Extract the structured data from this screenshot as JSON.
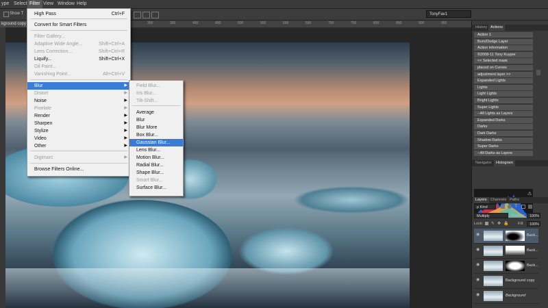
{
  "menubar": {
    "items": [
      "ype",
      "Select",
      "Filter",
      "View",
      "Window",
      "Help"
    ],
    "active_index": 2
  },
  "options": {
    "show_label": "Show T",
    "workspace": "TonyFav1"
  },
  "document": {
    "tab_label": "kground copy 5,",
    "ruler_ticks": [
      "50",
      "100",
      "150",
      "200",
      "250",
      "300",
      "350",
      "400",
      "450",
      "500",
      "550",
      "600",
      "650",
      "700",
      "750",
      "800",
      "850",
      "900",
      "950"
    ]
  },
  "filter_menu": {
    "items": [
      {
        "label": "High Pass",
        "shortcut": "Ctrl+F",
        "disabled": false
      },
      {
        "label": "Convert for Smart Filters",
        "shortcut": "",
        "disabled": false
      },
      {
        "label": "Filter Gallery...",
        "shortcut": "",
        "disabled": true
      },
      {
        "label": "Adaptive Wide Angle...",
        "shortcut": "Shift+Ctrl+A",
        "disabled": true
      },
      {
        "label": "Lens Correction...",
        "shortcut": "Shift+Ctrl+R",
        "disabled": true
      },
      {
        "label": "Liquify...",
        "shortcut": "Shift+Ctrl+X",
        "disabled": false
      },
      {
        "label": "Oil Paint...",
        "shortcut": "",
        "disabled": true
      },
      {
        "label": "Vanishing Point...",
        "shortcut": "Alt+Ctrl+V",
        "disabled": true
      },
      {
        "label": "Blur",
        "shortcut": "",
        "disabled": false,
        "submenu": true
      },
      {
        "label": "Distort",
        "shortcut": "",
        "disabled": true,
        "submenu": true
      },
      {
        "label": "Noise",
        "shortcut": "",
        "disabled": false,
        "submenu": true
      },
      {
        "label": "Pixelate",
        "shortcut": "",
        "disabled": true,
        "submenu": true
      },
      {
        "label": "Render",
        "shortcut": "",
        "disabled": false,
        "submenu": true
      },
      {
        "label": "Sharpen",
        "shortcut": "",
        "disabled": false,
        "submenu": true
      },
      {
        "label": "Stylize",
        "shortcut": "",
        "disabled": false,
        "submenu": true
      },
      {
        "label": "Video",
        "shortcut": "",
        "disabled": false,
        "submenu": true
      },
      {
        "label": "Other",
        "shortcut": "",
        "disabled": false,
        "submenu": true
      },
      {
        "label": "Digimarc",
        "shortcut": "",
        "disabled": true,
        "submenu": true
      },
      {
        "label": "Browse Filters Online...",
        "shortcut": "",
        "disabled": false
      }
    ]
  },
  "blur_menu": {
    "items": [
      {
        "label": "Field Blur...",
        "disabled": true
      },
      {
        "label": "Iris Blur...",
        "disabled": true
      },
      {
        "label": "Tilt-Shift...",
        "disabled": true
      },
      {
        "label": "Average",
        "disabled": false
      },
      {
        "label": "Blur",
        "disabled": false
      },
      {
        "label": "Blur More",
        "disabled": false
      },
      {
        "label": "Box Blur...",
        "disabled": false
      },
      {
        "label": "Gaussian Blur...",
        "disabled": false,
        "highlighted": true
      },
      {
        "label": "Lens Blur...",
        "disabled": false
      },
      {
        "label": "Motion Blur...",
        "disabled": false
      },
      {
        "label": "Radial Blur...",
        "disabled": false
      },
      {
        "label": "Shape Blur...",
        "disabled": false
      },
      {
        "label": "Smart Blur...",
        "disabled": true
      },
      {
        "label": "Surface Blur...",
        "disabled": false
      }
    ]
  },
  "actions_panel": {
    "tabs": [
      "History",
      "Actions"
    ],
    "items": [
      "Action 1",
      "Burn/Dodge Layer",
      "Action information",
      "©2008-11 Tony Kuyper",
      "<< Selected mask",
      "placed on Curves",
      "adjustment layer >>",
      "Expanded Lights",
      "Lights",
      "Light Lights",
      "Bright Lights",
      "Super Lights",
      "--All Lights as Layers",
      "Expanded Darks",
      "Darks",
      "Dark Darks",
      "Shadow Darks",
      "Super Darks",
      "--All Darks as Layers"
    ]
  },
  "navigator_panel": {
    "tabs": [
      "Navigator",
      "Histogram"
    ]
  },
  "layers_panel": {
    "tabs": [
      "Layers",
      "Channels",
      "Paths"
    ],
    "kind": "ρ Kind",
    "blend_mode": "Multiply",
    "opacity_label": "Opacity:",
    "opacity": "100%",
    "lock_label": "Lock:",
    "fill_label": "Fill:",
    "fill": "100%",
    "layers": [
      "Back...",
      "Back...",
      "Back...",
      "Background copy",
      "Background"
    ]
  },
  "colors": {
    "accent": "#3a7bd6",
    "menu_bg": "#f0f0f0",
    "panel_bg": "#3a3a3a"
  }
}
